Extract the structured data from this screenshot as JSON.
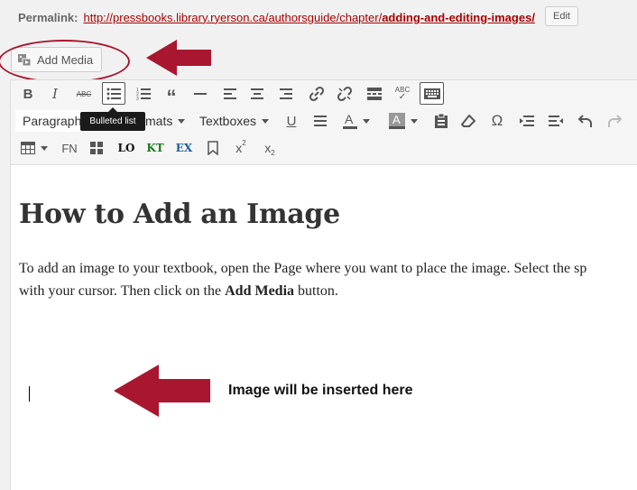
{
  "permalink": {
    "label": "Permalink:",
    "url_prefix": "http://pressbooks.library.ryerson.ca/authorsguide/chapter/",
    "url_slug": "adding-and-editing-images/",
    "edit_label": "Edit"
  },
  "add_media": {
    "label": "Add Media",
    "icon": "media-icon"
  },
  "toolbar": {
    "row1": [
      "bold-icon",
      "italic-icon",
      "strikethrough-icon",
      "bulleted-list-icon",
      "numbered-list-icon",
      "blockquote-icon",
      "horizontal-rule-icon",
      "align-left-icon",
      "align-center-icon",
      "align-right-icon",
      "link-icon",
      "unlink-icon",
      "read-more-icon",
      "spellcheck-icon",
      "toolbar-toggle-icon"
    ],
    "strike_text": "ABC",
    "spell_text": "ABC",
    "paragraph_label": "Paragraph",
    "formats_label": "Formats",
    "textboxes_label": "Textboxes",
    "tooltip": "Bulleted list",
    "fn_label": "FN",
    "lo_label": "LO",
    "kt_label": "KT",
    "ex_label": "EX",
    "sup_label": "x",
    "sup_mark": "2",
    "sub_label": "x",
    "sub_mark": "2"
  },
  "content": {
    "heading": "How to Add an Image",
    "para_line1": "To add an image to your textbook, open the Page where you want to place the image. Select the sp",
    "para_line2_pre": "with your cursor. Then click on the ",
    "para_line2_bold": "Add Media",
    "para_line2_post": " button.",
    "note": "Image will be inserted here"
  },
  "colors": {
    "annotation_red": "#a8172f",
    "link": "#aa0000",
    "kt_green": "#1a7a1a",
    "ex_blue": "#1a5fa0"
  }
}
